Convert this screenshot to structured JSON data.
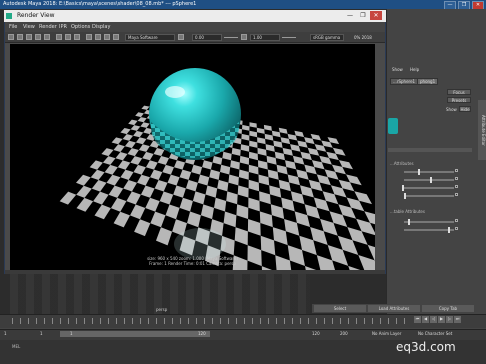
{
  "maya": {
    "title": "Autodesk Maya 2018: E:\\Basics\\maya\\scenes\\shader\\08_08.mb* --- pSphere1",
    "window_buttons": [
      "—",
      "❐",
      "✕"
    ]
  },
  "attribute_editor": {
    "tabs": [
      "...rSphere1",
      "phong1"
    ],
    "menu": [
      "Show",
      "Help"
    ],
    "buttons": [
      "Focus",
      "Presets",
      "Show",
      "Hide"
    ],
    "section_labels": [
      "...Attributes",
      "...table Attributes"
    ],
    "side_tab": "Attribute Editor"
  },
  "bottom_buttons": [
    "Select",
    "Load Attributes",
    "Copy Tab"
  ],
  "timeline": {
    "start": "1",
    "current": "1",
    "range_start": "1",
    "range_end": "120",
    "end": "120",
    "end2": "200",
    "anim_layer": "No Anim Layer",
    "char_set": "No Character Set"
  },
  "command_line": {
    "label": "MEL"
  },
  "watermark": "eq3d.com",
  "render_view": {
    "title": "Render View",
    "window_buttons": [
      "—",
      "❐",
      "✕"
    ],
    "menu": [
      "File",
      "View",
      "Render",
      "IPR",
      "Options",
      "Display"
    ],
    "renderer": "Maya Software",
    "exposure": "0.00",
    "gamma": "1.00",
    "color_mode": "sRGB gamma",
    "zoom": "0% 2018",
    "caption_line1": "size: 960 x 540  zoom: 1.000        (Maya Software)",
    "caption_line2": "Frame: 1       Render Time: 0:01       Camera: persp",
    "colors": {
      "sphere": "#1fb8b8",
      "floor_light": "#b7b7b7",
      "floor_dark": "#050505"
    }
  },
  "viewport_label": "persp"
}
